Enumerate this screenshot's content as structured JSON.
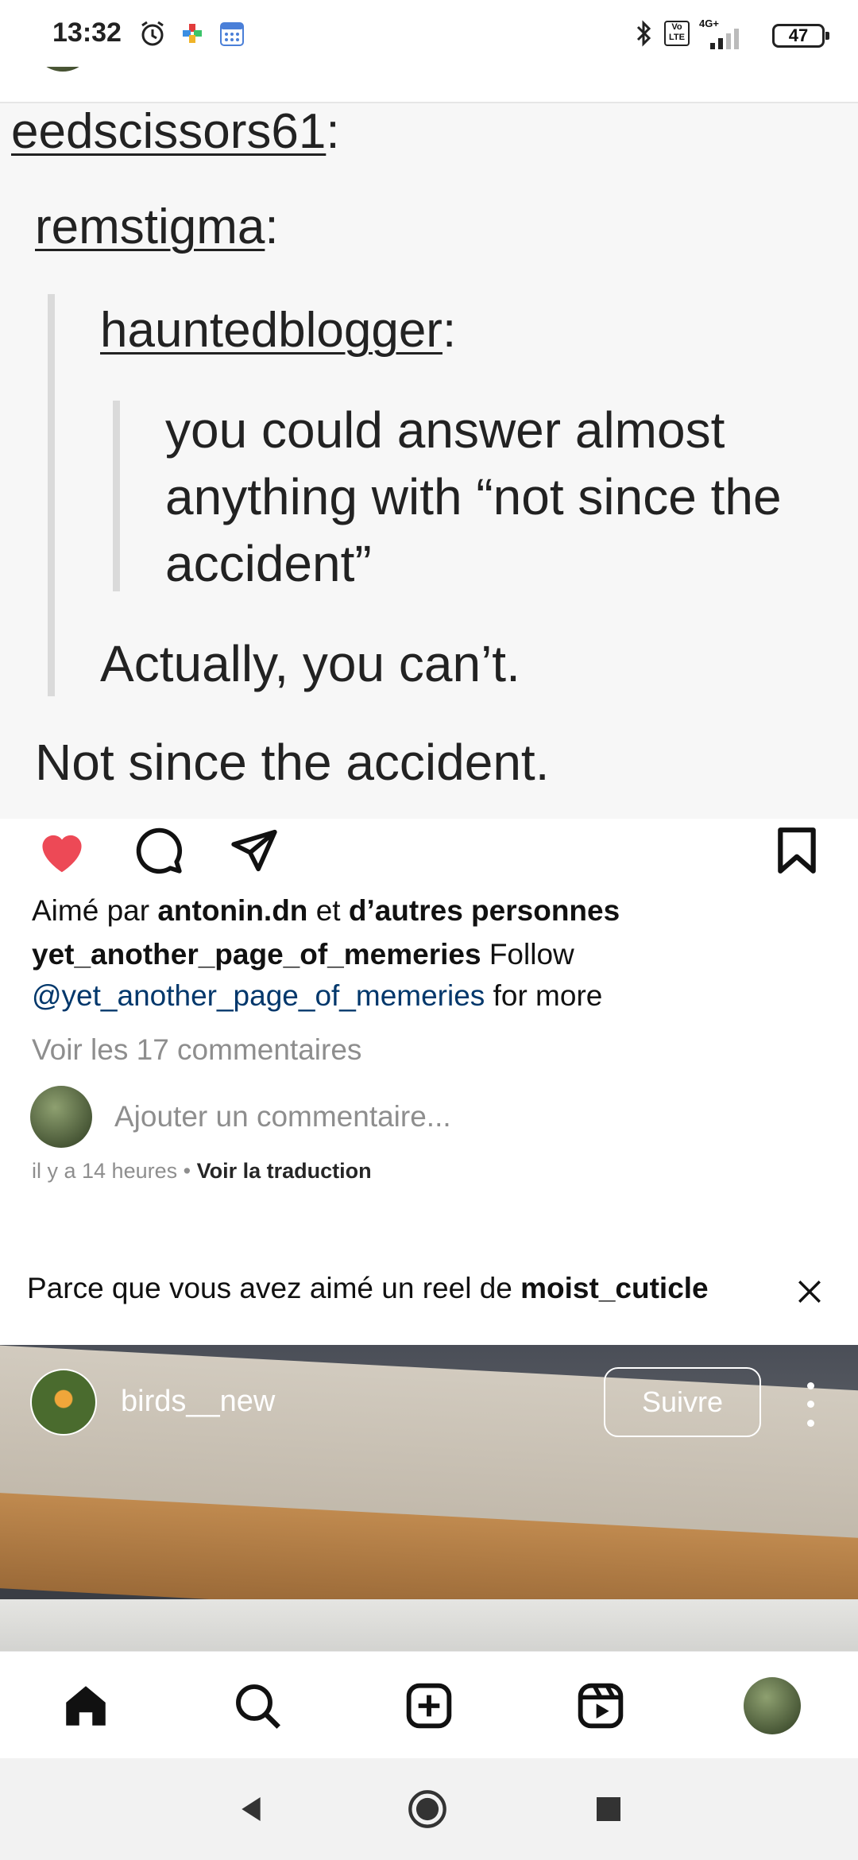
{
  "status_bar": {
    "time": "13:32",
    "battery": "47",
    "icons": [
      "alarm-icon",
      "app-icon",
      "calendar-icon",
      "bluetooth-icon",
      "volte-icon",
      "signal-icon"
    ],
    "network": "4G+",
    "volte": "Vo LTE"
  },
  "post": {
    "header_username": "yet_another_page_of_memeries",
    "meme": {
      "user1": "eedscissors61",
      "user2": "remstigma",
      "user3": "hauntedblogger",
      "quote_line1": "you could answer almost",
      "quote_line2": "anything with “not since the",
      "quote_line3": "accident”",
      "reply1": "Actually, you can’t.",
      "reply2": "Not since the accident."
    },
    "liked_prefix": "Aimé par ",
    "liked_user": "antonin.dn",
    "liked_middle": " et ",
    "liked_others": "d’autres personnes",
    "caption_username": "yet_another_page_of_memeries",
    "caption_text1": " Follow",
    "caption_mention": "@yet_another_page_of_memeries",
    "caption_text2": " for more",
    "view_comments": "Voir les 17 commentaires",
    "add_comment_placeholder": "Ajouter un commentaire...",
    "time_ago": "il y a 14 heures",
    "separator": " • ",
    "translate": "Voir la traduction"
  },
  "suggestion": {
    "text": "Parce que vous avez aimé un reel de ",
    "user": "moist_cuticle"
  },
  "reel": {
    "username": "birds__new",
    "follow_label": "Suivre"
  },
  "colors": {
    "heart": "#ed4956",
    "link": "#00376b",
    "muted": "#8e8e8e"
  }
}
